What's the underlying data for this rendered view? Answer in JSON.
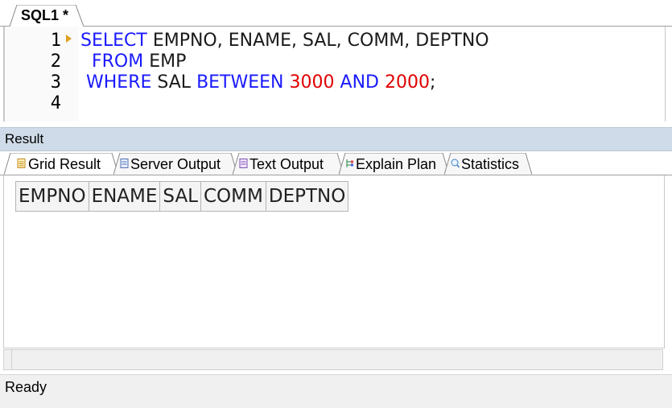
{
  "editor_tab": {
    "label": "SQL1 *"
  },
  "editor": {
    "line_numbers": [
      "1",
      "2",
      "3",
      "4"
    ],
    "lines": [
      [
        {
          "t": "SELECT",
          "c": "kw"
        },
        {
          "t": " EMPNO, ENAME, SAL, COMM, DEPTNO",
          "c": "plain"
        }
      ],
      [
        {
          "t": "  FROM",
          "c": "kw"
        },
        {
          "t": " EMP",
          "c": "plain"
        }
      ],
      [
        {
          "t": " WHERE",
          "c": "kw"
        },
        {
          "t": " SAL ",
          "c": "plain"
        },
        {
          "t": "BETWEEN",
          "c": "kw"
        },
        {
          "t": " ",
          "c": "plain"
        },
        {
          "t": "3000",
          "c": "num"
        },
        {
          "t": " ",
          "c": "plain"
        },
        {
          "t": "AND",
          "c": "kw"
        },
        {
          "t": " ",
          "c": "plain"
        },
        {
          "t": "2000",
          "c": "num"
        },
        {
          "t": ";",
          "c": "plain"
        }
      ],
      []
    ],
    "current_line_marker": "current-line-arrow-icon"
  },
  "result_panel": {
    "title": "Result"
  },
  "result_tabs": [
    {
      "label": "Grid Result",
      "icon": "grid-result-icon",
      "active": true
    },
    {
      "label": "Server Output",
      "icon": "server-output-icon",
      "active": false
    },
    {
      "label": "Text Output",
      "icon": "text-output-icon",
      "active": false
    },
    {
      "label": "Explain Plan",
      "icon": "explain-plan-icon",
      "active": false
    },
    {
      "label": "Statistics",
      "icon": "statistics-icon",
      "active": false
    }
  ],
  "grid": {
    "columns": [
      "EMPNO",
      "ENAME",
      "SAL",
      "COMM",
      "DEPTNO"
    ],
    "rows": []
  },
  "status": {
    "text": "Ready"
  },
  "colors": {
    "keyword": "#1a1aff",
    "number": "#e00000",
    "result_bar": "#cfdbe8"
  }
}
